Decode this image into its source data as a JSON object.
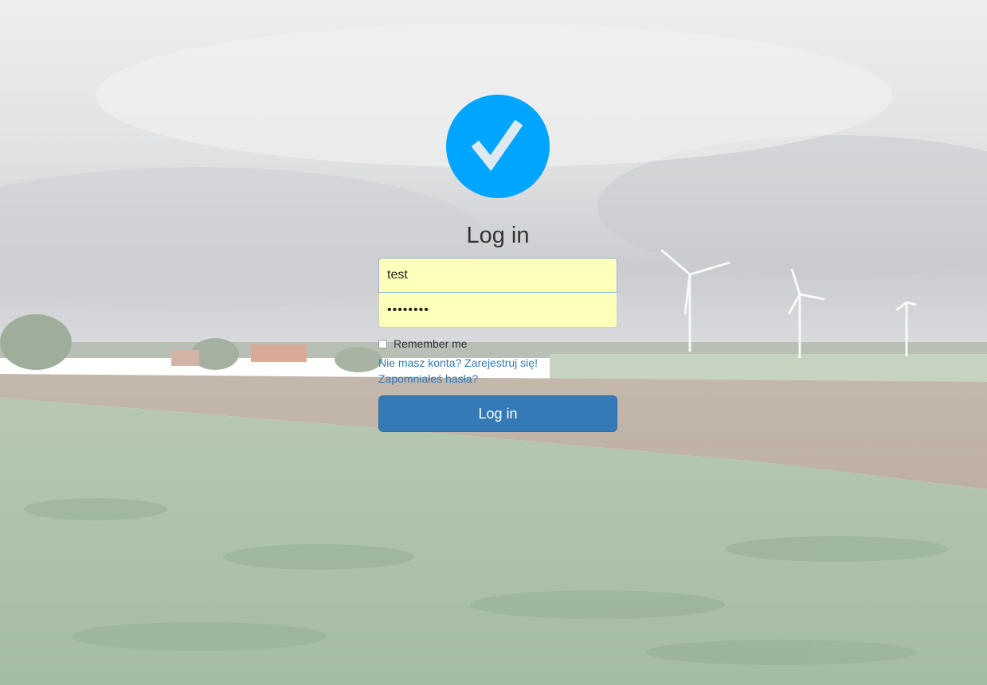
{
  "login": {
    "title": "Log in",
    "username_value": "test",
    "password_value": "••••••••",
    "remember_label": "Remember me",
    "remember_checked": false,
    "register_link": "Nie masz konta? Zarejestruj się!",
    "forgot_link": "Zapomniałeś hasła?",
    "submit_label": "Log in"
  },
  "logo": {
    "icon": "checkmark-icon",
    "circle_color": "#00a5ff",
    "check_color": "#dfe9f0"
  },
  "colors": {
    "input_autofill": "#ffffbc",
    "primary_button": "#337ab7",
    "link": "#337ab7"
  }
}
